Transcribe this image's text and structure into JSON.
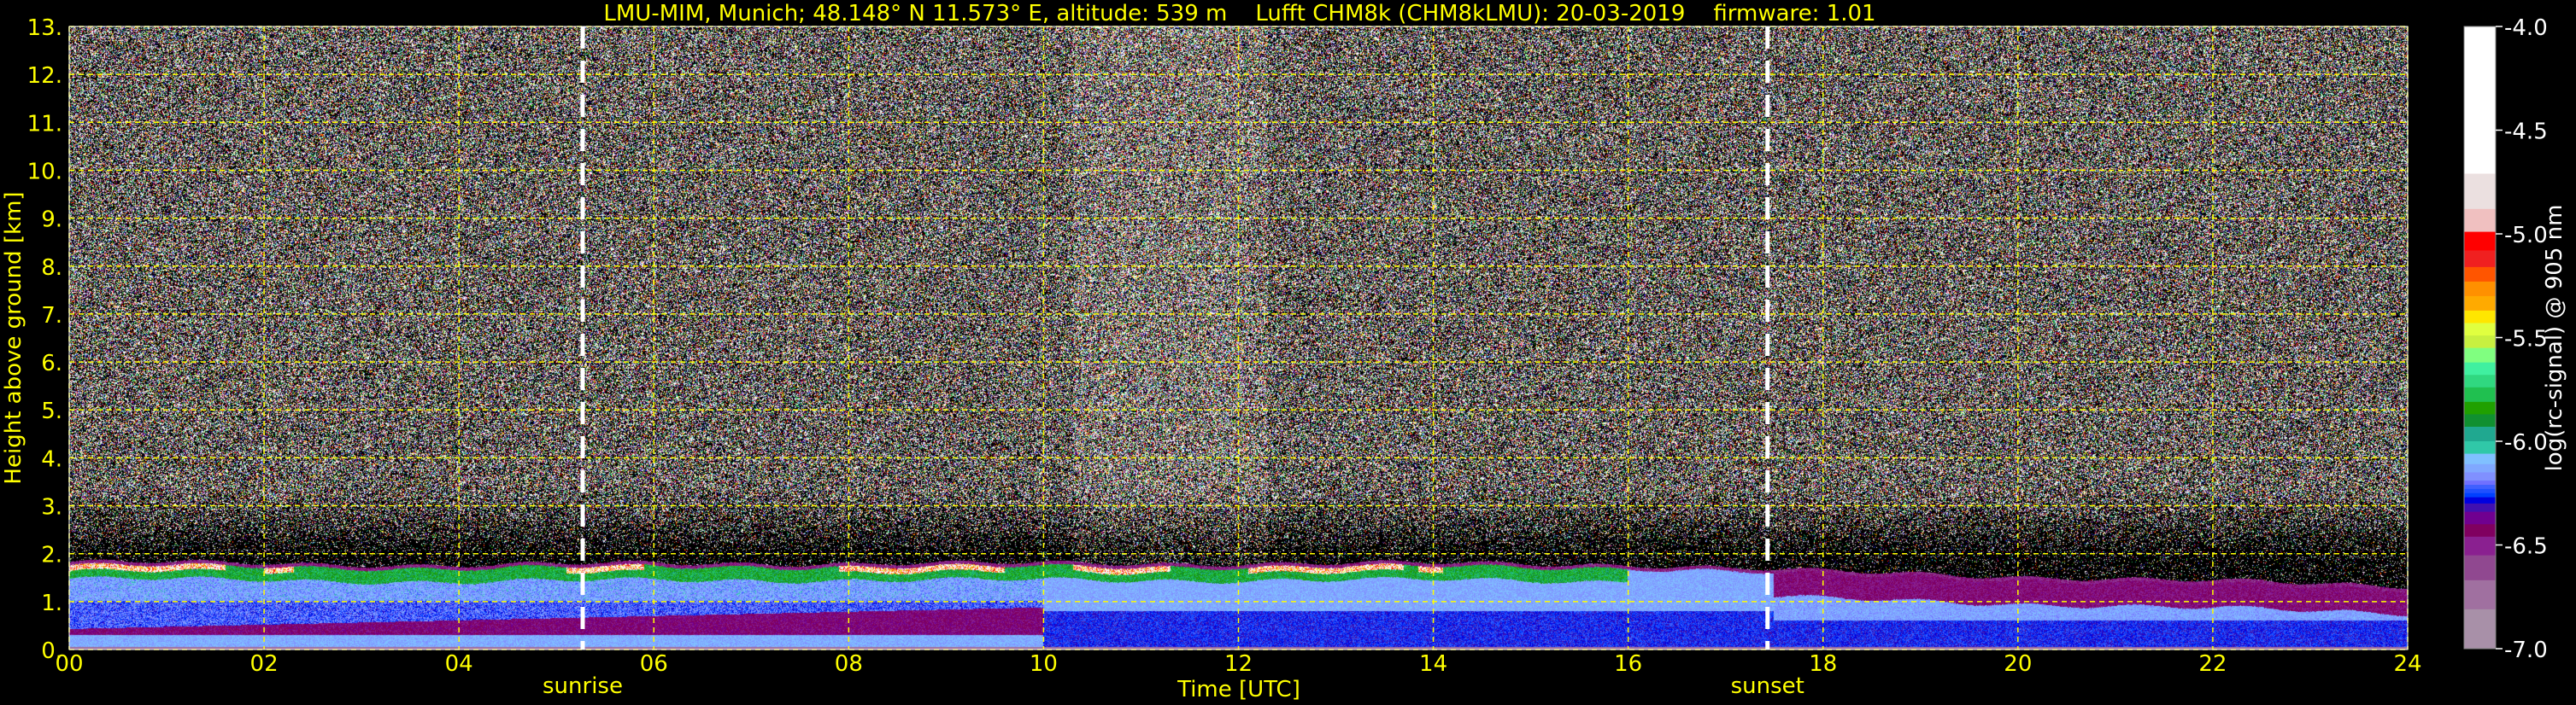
{
  "chart_data": {
    "type": "heatmap",
    "title": "LMU-MIM, Munich; 48.148° N 11.573° E, altitude: 539 m    Lufft CHM8k (CHM8kLMU): 20-03-2019    firmware: 1.01",
    "xlabel": "Time [UTC]",
    "ylabel": "Height above ground [km]",
    "xlim": [
      0,
      24
    ],
    "ylim": [
      0,
      13
    ],
    "xticks": [
      0,
      2,
      4,
      6,
      8,
      10,
      12,
      14,
      16,
      18,
      20,
      22,
      24
    ],
    "xtick_labels": [
      "00",
      "02",
      "04",
      "06",
      "08",
      "10",
      "12",
      "14",
      "16",
      "18",
      "20",
      "22",
      "24"
    ],
    "yticks": [
      0,
      1,
      2,
      3,
      4,
      5,
      6,
      7,
      8,
      9,
      10,
      11,
      12,
      13
    ],
    "ytick_labels": [
      "0.",
      "1.",
      "2.",
      "3.",
      "4.",
      "5.",
      "6.",
      "7.",
      "8.",
      "9.",
      "10.",
      "11.",
      "12.",
      "13."
    ],
    "grid": true,
    "grid_color": "#ffff00",
    "annotations": [
      {
        "label": "sunrise",
        "x": 5.27,
        "line_color": "#ffffff",
        "style": "dashed"
      },
      {
        "label": "sunset",
        "x": 17.43,
        "line_color": "#ffffff",
        "style": "dashed"
      }
    ],
    "boundary_layer_top_km": [
      [
        0,
        1.75
      ],
      [
        2,
        1.72
      ],
      [
        4,
        1.68
      ],
      [
        6,
        1.72
      ],
      [
        10,
        1.72
      ],
      [
        14,
        1.72
      ],
      [
        16,
        1.7
      ],
      [
        18,
        1.55
      ],
      [
        20,
        1.45
      ],
      [
        22,
        1.35
      ],
      [
        24,
        1.25
      ]
    ],
    "colorbar": {
      "label": "log(rc-signal) @ 905 nm",
      "range": [
        -7.0,
        -4.0
      ],
      "ticks": [
        -4.0,
        -4.5,
        -5.0,
        -5.5,
        -6.0,
        -6.5,
        -7.0
      ],
      "tick_labels": [
        "-4.0",
        "-4.5",
        "-5.0",
        "-5.5",
        "-6.0",
        "-6.5",
        "-7.0"
      ],
      "levels": [
        {
          "min": -4.71,
          "max": -4.0,
          "color": "#ffffff"
        },
        {
          "min": -4.88,
          "max": -4.71,
          "color": "#ebe0e0"
        },
        {
          "min": -4.99,
          "max": -4.88,
          "color": "#f0c0c0"
        },
        {
          "min": -5.08,
          "max": -4.99,
          "color": "#ff0000"
        },
        {
          "min": -5.16,
          "max": -5.08,
          "color": "#f02020"
        },
        {
          "min": -5.23,
          "max": -5.16,
          "color": "#ff5500"
        },
        {
          "min": -5.3,
          "max": -5.23,
          "color": "#ff9000"
        },
        {
          "min": -5.37,
          "max": -5.3,
          "color": "#ffaa00"
        },
        {
          "min": -5.43,
          "max": -5.37,
          "color": "#ffe600"
        },
        {
          "min": -5.49,
          "max": -5.43,
          "color": "#e0ff40"
        },
        {
          "min": -5.55,
          "max": -5.49,
          "color": "#c8f040"
        },
        {
          "min": -5.62,
          "max": -5.55,
          "color": "#80ff80"
        },
        {
          "min": -5.68,
          "max": -5.62,
          "color": "#40f0a0"
        },
        {
          "min": -5.74,
          "max": -5.68,
          "color": "#30d880"
        },
        {
          "min": -5.81,
          "max": -5.74,
          "color": "#20c050"
        },
        {
          "min": -5.87,
          "max": -5.81,
          "color": "#20a000"
        },
        {
          "min": -5.93,
          "max": -5.87,
          "color": "#109030"
        },
        {
          "min": -6.0,
          "max": -5.93,
          "color": "#20a890"
        },
        {
          "min": -6.06,
          "max": -6.0,
          "color": "#30c8a8"
        },
        {
          "min": -6.11,
          "max": -6.06,
          "color": "#80c0ff"
        },
        {
          "min": -6.15,
          "max": -6.11,
          "color": "#80a8ff"
        },
        {
          "min": -6.19,
          "max": -6.15,
          "color": "#8090ff"
        },
        {
          "min": -6.21,
          "max": -6.19,
          "color": "#7070ff"
        },
        {
          "min": -6.23,
          "max": -6.21,
          "color": "#4060ff"
        },
        {
          "min": -6.25,
          "max": -6.23,
          "color": "#2050ff"
        },
        {
          "min": -6.27,
          "max": -6.25,
          "color": "#0040ff"
        },
        {
          "min": -6.3,
          "max": -6.27,
          "color": "#0000e0"
        },
        {
          "min": -6.34,
          "max": -6.3,
          "color": "#4010b0"
        },
        {
          "min": -6.4,
          "max": -6.34,
          "color": "#700090"
        },
        {
          "min": -6.46,
          "max": -6.4,
          "color": "#800060"
        },
        {
          "min": -6.55,
          "max": -6.46,
          "color": "#8a2090"
        },
        {
          "min": -6.67,
          "max": -6.55,
          "color": "#904890"
        },
        {
          "min": -6.81,
          "max": -6.67,
          "color": "#a070a0"
        },
        {
          "min": -7.0,
          "max": -6.81,
          "color": "#a890a8"
        }
      ]
    }
  }
}
